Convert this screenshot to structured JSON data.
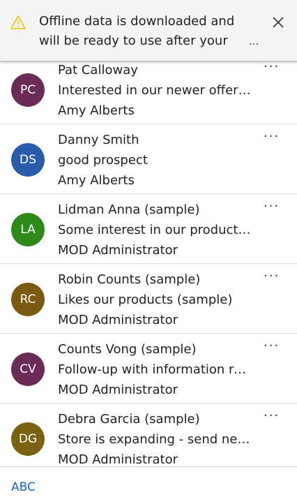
{
  "banner": {
    "message": "Offline data is downloaded and will be ready to use after your next",
    "more": "...",
    "icon": "warning-icon",
    "warning_color": "#f2c200"
  },
  "items": [
    {
      "initials": "PC",
      "color": "#6b2b57",
      "name": "Pat Calloway",
      "description": "Interested in our newer offerin...",
      "owner": "Amy Alberts"
    },
    {
      "initials": "DS",
      "color": "#2b5cab",
      "name": "Danny Smith",
      "description": "good prospect",
      "owner": "Amy Alberts"
    },
    {
      "initials": "LA",
      "color": "#2e8b1a",
      "name": "Lidman Anna (sample)",
      "description": "Some interest in our products ...",
      "owner": "MOD Administrator"
    },
    {
      "initials": "RC",
      "color": "#7a5a10",
      "name": "Robin Counts (sample)",
      "description": "Likes our products (sample)",
      "owner": "MOD Administrator"
    },
    {
      "initials": "CV",
      "color": "#6b2b57",
      "name": "Counts Vong (sample)",
      "description": "Follow-up with information re...",
      "owner": "MOD Administrator"
    },
    {
      "initials": "DG",
      "color": "#7a6210",
      "name": "Debra Garcia (sample)",
      "description": "Store is expanding - send new...",
      "owner": "MOD Administrator"
    }
  ],
  "more_label": "···",
  "footer": {
    "abc": "ABC"
  }
}
